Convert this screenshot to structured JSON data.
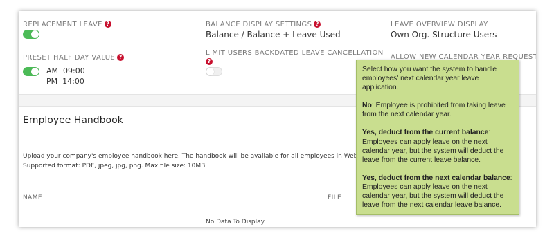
{
  "settings": {
    "replacement_leave": {
      "label": "REPLACEMENT LEAVE",
      "enabled": true
    },
    "balance_display": {
      "label": "BALANCE DISPLAY SETTINGS",
      "value": "Balance / Balance + Leave Used"
    },
    "leave_overview": {
      "label": "LEAVE OVERVIEW DISPLAY",
      "value": "Own Org. Structure Users"
    },
    "preset_half_day": {
      "label": "PRESET HALF DAY VALUE",
      "enabled": true,
      "am_label": "AM",
      "am_time": "09:00",
      "pm_label": "PM",
      "pm_time": "14:00"
    },
    "limit_backdated": {
      "label": "LIMIT USERS BACKDATED LEAVE CANCELLATION",
      "enabled": false
    },
    "allow_new_year": {
      "label": "ALLOW NEW CALENDAR YEAR REQUEST"
    },
    "help_glyph": "?"
  },
  "handbook": {
    "title": "Employee Handbook",
    "description_line1": "Upload your company's employee handbook here. The handbook will be available for all employees in Web s",
    "description_line2": "Supported format: PDF, jpeg, jpg, png. Max file size: 10MB",
    "col_name": "NAME",
    "col_file": "FILE",
    "empty_text": "No Data To Display"
  },
  "tooltip": {
    "intro": "Select how you want the system to handle employees' next calendar year leave application.",
    "opt1_title": "No",
    "opt1_text": ": Employee is prohibited from taking leave from the next calendar year.",
    "opt2_title": "Yes, deduct from the current balance",
    "opt2_text": ": Employees can apply leave on the next calendar year, but the system will deduct the leave from the current leave balance.",
    "opt3_title": "Yes, deduct from the next calendar balance",
    "opt3_text": ": Employees can apply leave on the next calendar year, but the system will deduct the leave from the next calendar leave balance."
  },
  "colors": {
    "toggle_on": "#4cbb57",
    "help_icon": "#c8102e",
    "tooltip_bg": "#c9de8f"
  }
}
